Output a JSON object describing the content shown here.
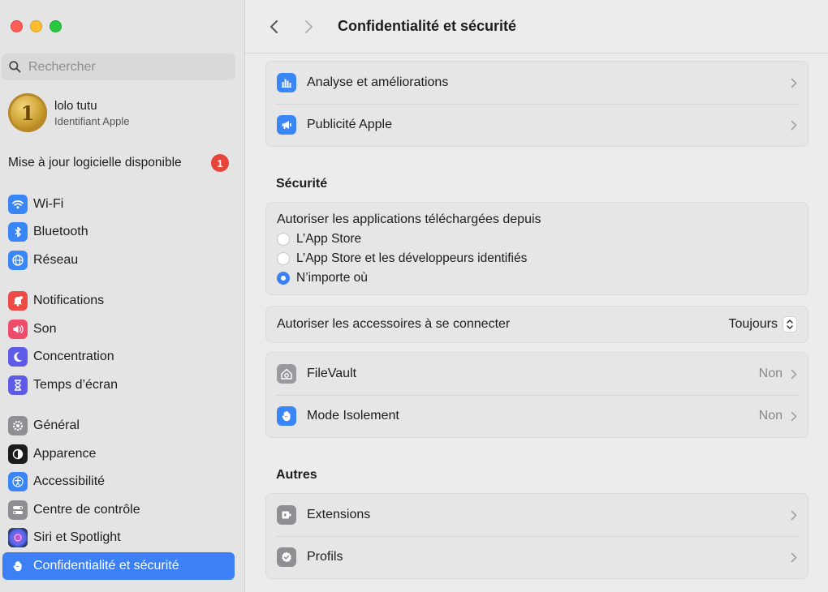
{
  "sidebar": {
    "search_placeholder": "Rechercher",
    "account": {
      "name": "lolo tutu",
      "subtitle": "Identifiant Apple",
      "avatar_text": "1"
    },
    "update": {
      "label": "Mise à jour logicielle disponible",
      "badge": "1"
    },
    "items": [
      {
        "label": "Wi-Fi",
        "icon": "wifi-icon",
        "color": "#3a86f7"
      },
      {
        "label": "Bluetooth",
        "icon": "bluetooth-icon",
        "color": "#3a86f7"
      },
      {
        "label": "Réseau",
        "icon": "globe-icon",
        "color": "#3a86f7"
      },
      {
        "label": "Notifications",
        "icon": "bell-icon",
        "color": "#ef4b46"
      },
      {
        "label": "Son",
        "icon": "speaker-icon",
        "color": "#ef4b6b"
      },
      {
        "label": "Concentration",
        "icon": "moon-icon",
        "color": "#5e5ce6"
      },
      {
        "label": "Temps d’écran",
        "icon": "hourglass-icon",
        "color": "#5e5ce6"
      },
      {
        "label": "Général",
        "icon": "gear-icon",
        "color": "#8e8e93"
      },
      {
        "label": "Apparence",
        "icon": "appearance-icon",
        "color": "#1c1c1e"
      },
      {
        "label": "Accessibilité",
        "icon": "accessibility-icon",
        "color": "#3a86f7"
      },
      {
        "label": "Centre de contrôle",
        "icon": "toggles-icon",
        "color": "#8e8e93"
      },
      {
        "label": "Siri et Spotlight",
        "icon": "siri-icon",
        "color": "#2b2b3a"
      },
      {
        "label": "Confidentialité et sécurité",
        "icon": "hand-icon",
        "color": "#3a86f7",
        "active": true
      }
    ]
  },
  "header": {
    "title": "Confidentialité et sécurité"
  },
  "main": {
    "top_rows": [
      {
        "label": "Analyse et améliorations",
        "icon": "chart-icon"
      },
      {
        "label": "Publicité Apple",
        "icon": "megaphone-icon"
      }
    ],
    "security": {
      "title": "Sécurité",
      "allow_title": "Autoriser les applications téléchargées depuis",
      "options": [
        {
          "label": "L’App Store",
          "selected": false
        },
        {
          "label": "L’App Store et les développeurs identifiés",
          "selected": false
        },
        {
          "label": "N’importe où",
          "selected": true
        }
      ],
      "accessories": {
        "label": "Autoriser les accessoires à se connecter",
        "value": "Toujours"
      },
      "filevault": {
        "label": "FileVault",
        "value": "Non"
      },
      "lockdown": {
        "label": "Mode Isolement",
        "value": "Non"
      }
    },
    "others": {
      "title": "Autres",
      "rows": [
        {
          "label": "Extensions",
          "icon": "extensions-icon"
        },
        {
          "label": "Profils",
          "icon": "profile-badge-icon"
        }
      ]
    }
  },
  "colors": {
    "accent": "#3d7ff5",
    "badge": "#e7443a"
  }
}
